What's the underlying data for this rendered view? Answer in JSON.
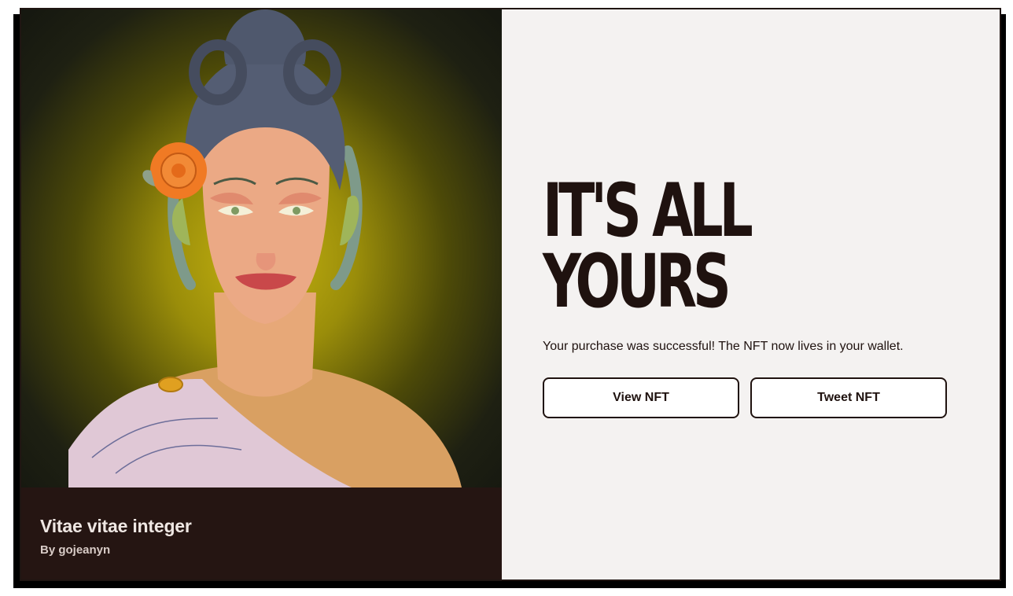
{
  "nft": {
    "title": "Vitae vitae integer",
    "creator": "By gojeanyn",
    "image_icon": "nft-portrait-illustration"
  },
  "success": {
    "headline_line1": "IT'S ALL",
    "headline_line2": "YOURS",
    "message": "Your purchase was successful! The NFT now lives in your wallet."
  },
  "actions": {
    "view_label": "View NFT",
    "tweet_label": "Tweet NFT"
  },
  "colors": {
    "dark_brown": "#251512",
    "text_dark": "#1f120f",
    "panel_bg": "#f4f2f1",
    "art_glow": "#c7b410"
  }
}
